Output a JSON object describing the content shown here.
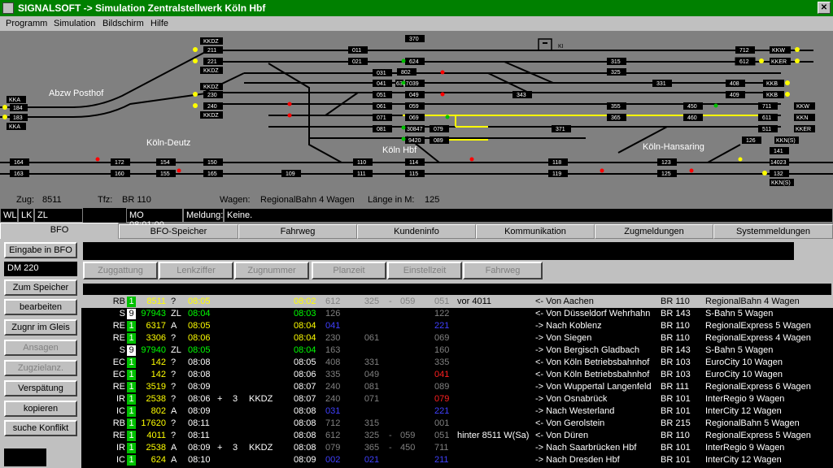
{
  "window": {
    "title": "SIGNALSOFT -> Simulation Zentralstellwerk Köln Hbf"
  },
  "menu": [
    "Programm",
    "Simulation",
    "Bildschirm",
    "Hilfe"
  ],
  "colors": {
    "titlebar": "#008000",
    "block": "#000000",
    "signal_green": "#00c000",
    "signal_red": "#ff0000",
    "track_yellow": "#ffff00",
    "track_black": "#000000",
    "background": "#808080"
  },
  "schematic": {
    "stations": [
      "Abzw Posthof",
      "Köln-Deutz",
      "Köln Hbf",
      "Köln-Hansaring"
    ],
    "ki_label": "KI",
    "blocks": {
      "left": [
        "KKA",
        "184",
        "183",
        "KKA"
      ],
      "deutz_top": [
        "KKDZ",
        "211",
        "221",
        "KKDZ",
        "KKDZ",
        "230",
        "240",
        "KKDZ"
      ],
      "deutz_bottom": [
        "164",
        "163",
        "172",
        "160",
        "154",
        "155",
        "150",
        "165",
        "109"
      ],
      "center_top": [
        "011",
        "021",
        "031",
        "041",
        "051",
        "061",
        "071",
        "081"
      ],
      "center_mid": [
        "370",
        "624",
        "802",
        "039",
        "6317",
        "049",
        "059",
        "069",
        "30847",
        "9420",
        "079",
        "089"
      ],
      "center_low": [
        "110",
        "111",
        "114",
        "115",
        "118",
        "119"
      ],
      "right": [
        "315",
        "325",
        "331",
        "343",
        "355",
        "365",
        "371",
        "450",
        "460",
        "123",
        "125"
      ],
      "far_right": [
        "712",
        "KKW",
        "612",
        "KKER",
        "408",
        "KKB",
        "409",
        "KKB",
        "711",
        "KKW",
        "511",
        "KKER",
        "611",
        "KKN",
        "126",
        "KKN(S)",
        "141",
        "14023",
        "132",
        "KKN(S)"
      ]
    }
  },
  "info": {
    "zug_label": "Zug:",
    "zug": "8511",
    "tfz_label": "Tfz:",
    "tfz": "BR 110",
    "wagen_label": "Wagen:",
    "wagen": "RegionalBahn 4 Wagen",
    "laenge_label": "Länge in M:",
    "laenge": "125"
  },
  "status": {
    "wl": "WL",
    "lk": "LK",
    "zl": "ZL",
    "time": "MO 08:01:00",
    "meldung_label": "Meldung:",
    "meldung": "Keine."
  },
  "tabs": [
    "BFO",
    "BFO-Speicher",
    "Fahrweg",
    "Kundeninfo",
    "Kommunikation",
    "Zugmeldungen",
    "Systemmeldungen"
  ],
  "left_buttons": {
    "eingabe": "Eingabe in BFO",
    "field": "DM 220",
    "speicher": "Zum Speicher",
    "bearbeiten": "bearbeiten",
    "zugnr": "Zugnr im Gleis",
    "ansagen": "Ansagen",
    "zugzielanz": "Zugzielanz.",
    "verspaetung": "Verspätung",
    "kopieren": "kopieren",
    "konflikt": "suche Konflikt"
  },
  "field_buttons": [
    "Zuggattung",
    "Lenkziffer",
    "Zugnummer",
    "Planzeit",
    "Einstellzeit",
    "Fahrweg"
  ],
  "rows": [
    {
      "gat": "RB",
      "zf": "1",
      "zfw": false,
      "nr": "8511",
      "nrg": false,
      "q": "?",
      "plan": "08:05",
      "pc": "y",
      "plus": "",
      "min": "",
      "kkdz": "",
      "ein": "08:02",
      "ec": "y",
      "a": "612",
      "b": "325",
      "dash": "-",
      "c": "059",
      "g": "051",
      "gc": "#808080",
      "note": "vor 4011",
      "dir": "<- Von Aachen",
      "br": "BR 110",
      "wagen": "RegionalBahn 4 Wagen",
      "sel": true
    },
    {
      "gat": "S",
      "zf": "9",
      "zfw": true,
      "nr": "97943",
      "nrg": true,
      "q": "ZL",
      "plan": "08:04",
      "pc": "g",
      "plus": "",
      "min": "",
      "kkdz": "",
      "ein": "08:03",
      "ec": "g",
      "a": "126",
      "b": "",
      "dash": "",
      "c": "",
      "g": "122",
      "gc": "#808080",
      "note": "",
      "dir": "<- Von Düsseldorf Wehrhahn",
      "br": "BR 143",
      "wagen": "S-Bahn 5 Wagen",
      "sel": false
    },
    {
      "gat": "RE",
      "zf": "1",
      "zfw": false,
      "nr": "6317",
      "nrg": false,
      "q": "A",
      "plan": "08:05",
      "pc": "y",
      "plus": "",
      "min": "",
      "kkdz": "",
      "ein": "08:04",
      "ec": "y",
      "a": "041",
      "b": "",
      "dash": "",
      "c": "",
      "g": "221",
      "gc": "#4040ff",
      "note": "",
      "dir": "-> Nach Koblenz",
      "br": "BR 110",
      "wagen": "RegionalExpress 5 Wagen",
      "sel": false,
      "ac": "#4040ff"
    },
    {
      "gat": "RE",
      "zf": "1",
      "zfw": false,
      "nr": "3306",
      "nrg": false,
      "q": "?",
      "plan": "08:06",
      "pc": "y",
      "plus": "",
      "min": "",
      "kkdz": "",
      "ein": "08:04",
      "ec": "y",
      "a": "230",
      "b": "061",
      "dash": "",
      "c": "",
      "g": "069",
      "gc": "#808080",
      "note": "",
      "dir": "-> Von Siegen",
      "br": "BR 110",
      "wagen": "RegionalExpress 4 Wagen",
      "sel": false
    },
    {
      "gat": "S",
      "zf": "9",
      "zfw": true,
      "nr": "97940",
      "nrg": true,
      "q": "ZL",
      "plan": "08:05",
      "pc": "g",
      "plus": "",
      "min": "",
      "kkdz": "",
      "ein": "08:04",
      "ec": "g",
      "a": "163",
      "b": "",
      "dash": "",
      "c": "",
      "g": "160",
      "gc": "#808080",
      "note": "",
      "dir": "-> Von Bergisch Gladbach",
      "br": "BR 143",
      "wagen": "S-Bahn 5 Wagen",
      "sel": false
    },
    {
      "gat": "EC",
      "zf": "1",
      "zfw": false,
      "nr": "142",
      "nrg": false,
      "q": "?",
      "plan": "08:08",
      "pc": "w",
      "plus": "",
      "min": "",
      "kkdz": "",
      "ein": "08:05",
      "ec": "w",
      "a": "408",
      "b": "331",
      "dash": "",
      "c": "",
      "g": "335",
      "gc": "#808080",
      "note": "",
      "dir": "<- Von Köln Betriebsbahnhof",
      "br": "BR 103",
      "wagen": "EuroCity 10 Wagen",
      "sel": false
    },
    {
      "gat": "EC",
      "zf": "1",
      "zfw": false,
      "nr": "142",
      "nrg": false,
      "q": "?",
      "plan": "08:08",
      "pc": "w",
      "plus": "",
      "min": "",
      "kkdz": "",
      "ein": "08:06",
      "ec": "w",
      "a": "335",
      "b": "049",
      "dash": "",
      "c": "",
      "g": "041",
      "gc": "#ff2020",
      "note": "",
      "dir": "<- Von Köln Betriebsbahnhof",
      "br": "BR 103",
      "wagen": "EuroCity 10 Wagen",
      "sel": false
    },
    {
      "gat": "RE",
      "zf": "1",
      "zfw": false,
      "nr": "3519",
      "nrg": false,
      "q": "?",
      "plan": "08:09",
      "pc": "w",
      "plus": "",
      "min": "",
      "kkdz": "",
      "ein": "08:07",
      "ec": "w",
      "a": "240",
      "b": "081",
      "dash": "",
      "c": "",
      "g": "089",
      "gc": "#808080",
      "note": "",
      "dir": "-> Von Wuppertal Langenfeld",
      "br": "BR 111",
      "wagen": "RegionalExpress 6 Wagen",
      "sel": false
    },
    {
      "gat": "IR",
      "zf": "1",
      "zfw": false,
      "nr": "2538",
      "nrg": false,
      "q": "?",
      "plan": "08:06",
      "pc": "w",
      "plus": "+",
      "min": "3",
      "kkdz": "KKDZ",
      "ein": "08:07",
      "ec": "w",
      "a": "240",
      "b": "071",
      "dash": "",
      "c": "",
      "g": "079",
      "gc": "#ff2020",
      "note": "",
      "dir": "-> Von Osnabrück",
      "br": "BR 101",
      "wagen": "InterRegio 9 Wagen",
      "sel": false
    },
    {
      "gat": "IC",
      "zf": "1",
      "zfw": false,
      "nr": "802",
      "nrg": false,
      "q": "A",
      "plan": "08:09",
      "pc": "w",
      "plus": "",
      "min": "",
      "kkdz": "",
      "ein": "08:08",
      "ec": "w",
      "a": "031",
      "b": "",
      "dash": "",
      "c": "",
      "g": "221",
      "gc": "#4040ff",
      "note": "",
      "dir": "-> Nach Westerland",
      "br": "BR 101",
      "wagen": "InterCity 12 Wagen",
      "sel": false,
      "ac": "#4040ff"
    },
    {
      "gat": "RB",
      "zf": "1",
      "zfw": false,
      "nr": "17620",
      "nrg": false,
      "q": "?",
      "plan": "08:11",
      "pc": "w",
      "plus": "",
      "min": "",
      "kkdz": "",
      "ein": "08:08",
      "ec": "w",
      "a": "712",
      "b": "315",
      "dash": "",
      "c": "",
      "g": "001",
      "gc": "#808080",
      "note": "",
      "dir": "<- Von Gerolstein",
      "br": "BR 215",
      "wagen": "RegionalBahn 5 Wagen",
      "sel": false
    },
    {
      "gat": "RE",
      "zf": "1",
      "zfw": false,
      "nr": "4011",
      "nrg": false,
      "q": "?",
      "plan": "08:11",
      "pc": "w",
      "plus": "",
      "min": "",
      "kkdz": "",
      "ein": "08:08",
      "ec": "w",
      "a": "612",
      "b": "325",
      "dash": "-",
      "c": "059",
      "g": "051",
      "gc": "#808080",
      "note": "hinter 8511 W(Sa)",
      "dir": "<- Von Düren",
      "br": "BR 110",
      "wagen": "RegionalExpress 5 Wagen",
      "sel": false
    },
    {
      "gat": "IR",
      "zf": "1",
      "zfw": false,
      "nr": "2538",
      "nrg": false,
      "q": "A",
      "plan": "08:09",
      "pc": "w",
      "plus": "+",
      "min": "3",
      "kkdz": "KKDZ",
      "ein": "08:08",
      "ec": "w",
      "a": "079",
      "b": "365",
      "dash": "-",
      "c": "450",
      "g": "711",
      "gc": "#808080",
      "note": "",
      "dir": "-> Nach Saarbrücken Hbf",
      "br": "BR 101",
      "wagen": "InterRegio 9 Wagen",
      "sel": false
    },
    {
      "gat": "IC",
      "zf": "1",
      "zfw": false,
      "nr": "624",
      "nrg": false,
      "q": "A",
      "plan": "08:10",
      "pc": "w",
      "plus": "",
      "min": "",
      "kkdz": "",
      "ein": "08:09",
      "ec": "w",
      "a": "002",
      "b": "021",
      "dash": "",
      "c": "",
      "g": "211",
      "gc": "#4040ff",
      "note": "",
      "dir": "-> Nach Dresden Hbf",
      "br": "BR 101",
      "wagen": "InterCity 12 Wagen",
      "sel": false,
      "ac": "#4040ff",
      "bc": "#4040ff"
    }
  ]
}
